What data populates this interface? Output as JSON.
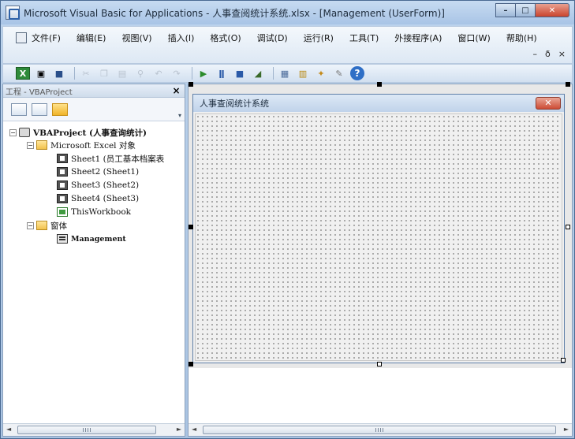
{
  "window": {
    "title": "Microsoft Visual Basic for Applications - 人事查阅统计系统.xlsx - [Management (UserForm)]",
    "controls": {
      "minimize": "–",
      "maximize": "□",
      "close": "✕"
    }
  },
  "menu": {
    "items": [
      "文件(F)",
      "编辑(E)",
      "视图(V)",
      "插入(I)",
      "格式(O)",
      "调试(D)",
      "运行(R)",
      "工具(T)",
      "外接程序(A)",
      "窗口(W)",
      "帮助(H)"
    ],
    "mdi": {
      "minimize": "–",
      "restore": "ð",
      "close": "×"
    }
  },
  "toolbar": {
    "icons": [
      "excel-icon",
      "insert-userform-icon",
      "save-icon",
      "cut-icon",
      "copy-icon",
      "paste-icon",
      "find-icon",
      "undo-icon",
      "redo-icon",
      "run-icon",
      "break-icon",
      "reset-icon",
      "design-mode-icon",
      "project-explorer-icon",
      "properties-icon",
      "object-browser-icon",
      "toolbox-icon",
      "help-icon"
    ]
  },
  "project": {
    "title": "工程 - VBAProject",
    "close": "×",
    "tree": {
      "root": "VBAProject (人事查询统计)",
      "excel_folder": "Microsoft Excel 对象",
      "sheets": [
        "Sheet1 (员工基本档案表",
        "Sheet2 (Sheet1)",
        "Sheet3 (Sheet2)",
        "Sheet4 (Sheet3)"
      ],
      "workbook": "ThisWorkbook",
      "forms_folder": "窗体",
      "form": "Management"
    }
  },
  "userform": {
    "caption": "人事查阅统计系统",
    "close": "✕"
  },
  "scroll": {
    "left": "◄",
    "right": "►"
  }
}
